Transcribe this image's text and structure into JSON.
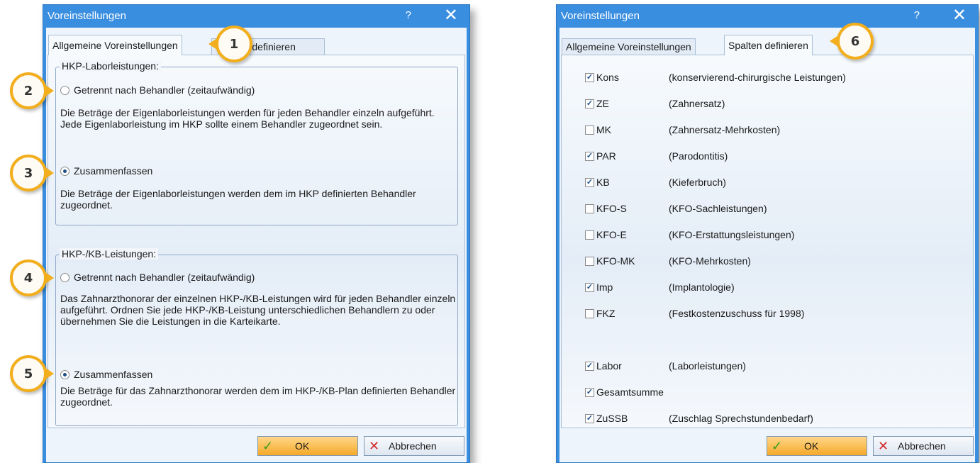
{
  "left_dialog": {
    "title": "Voreinstellungen",
    "help_label": "?",
    "close_label": "✕",
    "tabs": [
      {
        "label": "Allgemeine Voreinstellungen"
      },
      {
        "label": "Spalten definieren"
      }
    ],
    "group_labor": {
      "legend": "HKP-Laborleistungen:",
      "option_separate": "Getrennt nach Behandler (zeitaufwändig)",
      "desc_separate": "Die Beträge der Eigenlaborleistungen werden für jeden Behandler einzeln aufgeführt. Jede Eigenlaborleistung im HKP sollte einem Behandler zugeordnet sein.",
      "option_combine": "Zusammenfassen",
      "desc_combine": "Die Beträge der Eigenlaborleistungen werden dem im HKP definierten Behandler zugeordnet.",
      "selected": "Zusammenfassen"
    },
    "group_kb": {
      "legend": "HKP-/KB-Leistungen:",
      "option_separate": "Getrennt nach Behandler (zeitaufwändig)",
      "desc_separate": "Das Zahnarzthonorar der einzelnen HKP-/KB-Leistungen wird für jeden Behandler einzeln aufgeführt. Ordnen Sie jede HKP-/KB-Leistung unterschiedlichen Behandlern zu oder übernehmen Sie die Leistungen in die Karteikarte.",
      "option_combine": "Zusammenfassen",
      "desc_combine": "Die Beträge für das Zahnarzthonorar werden dem im HKP-/KB-Plan definierten Behandler zugeordnet.",
      "selected": "Zusammenfassen"
    },
    "ok_label": "OK",
    "cancel_label": "Abbrechen"
  },
  "right_dialog": {
    "title": "Voreinstellungen",
    "help_label": "?",
    "close_label": "✕",
    "tabs": [
      {
        "label": "Allgemeine Voreinstellungen"
      },
      {
        "label": "Spalten definieren"
      }
    ],
    "columns": [
      {
        "label": "Kons",
        "desc": "(konservierend-chirurgische Leistungen)",
        "checked": true
      },
      {
        "label": "ZE",
        "desc": "(Zahnersatz)",
        "checked": true
      },
      {
        "label": "MK",
        "desc": "(Zahnersatz-Mehrkosten)",
        "checked": false
      },
      {
        "label": "PAR",
        "desc": "(Parodontitis)",
        "checked": true
      },
      {
        "label": "KB",
        "desc": "(Kieferbruch)",
        "checked": true
      },
      {
        "label": "KFO-S",
        "desc": "(KFO-Sachleistungen)",
        "checked": false
      },
      {
        "label": "KFO-E",
        "desc": "(KFO-Erstattungsleistungen)",
        "checked": false
      },
      {
        "label": "KFO-MK",
        "desc": "(KFO-Mehrkosten)",
        "checked": false
      },
      {
        "label": "Imp",
        "desc": "(Implantologie)",
        "checked": true
      },
      {
        "label": "FKZ",
        "desc": "(Festkostenzuschuss für 1998)",
        "checked": false
      },
      {
        "label": "Labor",
        "desc": "(Laborleistungen)",
        "checked": true
      },
      {
        "label": "Gesamtsumme",
        "desc": "",
        "checked": true
      },
      {
        "label": "ZuSSB",
        "desc": "(Zuschlag Sprechstundenbedarf)",
        "checked": true
      }
    ],
    "ok_label": "OK",
    "cancel_label": "Abbrechen"
  },
  "callouts": [
    "1",
    "2",
    "3",
    "4",
    "5",
    "6"
  ],
  "colors": {
    "titlebar": "#3a8ee0",
    "callout_ring": "#f2ae1c",
    "ok_button": "#f6a928"
  }
}
